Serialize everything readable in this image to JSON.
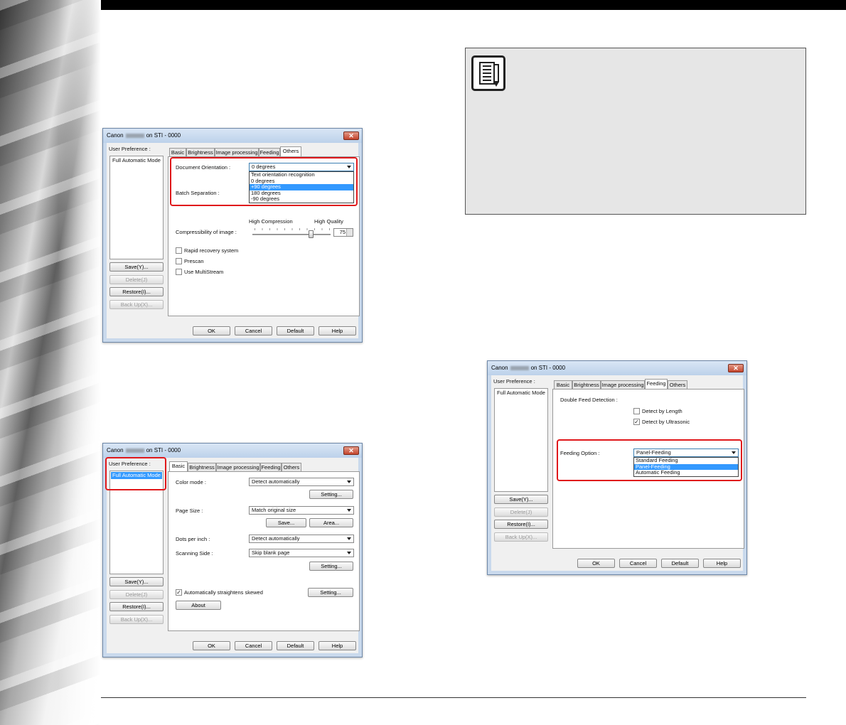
{
  "dialog_title": {
    "prefix": "Canon",
    "suffix": "on STI - 0000",
    "close": "✕"
  },
  "common": {
    "user_preference": "User Preference :",
    "preset_item": "Full Automatic Mode",
    "save": "Save(Y)...",
    "delete": "Delete(J)",
    "restore": "Restore(I)...",
    "backup": "Back Up(X)...",
    "ok": "OK",
    "cancel": "Cancel",
    "default": "Default",
    "help": "Help"
  },
  "tabs": [
    "Basic",
    "Brightness",
    "Image processing",
    "Feeding",
    "Others"
  ],
  "dialog1": {
    "active_tab": "Others",
    "doc_orientation_label": "Document Orientation :",
    "doc_orientation_value": "0 degrees",
    "orientation_options": [
      "Text orientation recognition",
      "0 degrees",
      "+90 degrees",
      "180 degrees",
      "-90 degrees"
    ],
    "orientation_selected_index": 2,
    "batch_separation_label": "Batch Separation :",
    "high_compression": "High Compression",
    "high_quality": "High Quality",
    "compressibility_label": "Compressibility of image :",
    "compressibility_value": "75",
    "compressibility_level": 0.75,
    "rapid_recovery": "Rapid recovery system",
    "prescan": "Prescan",
    "multistream": "Use MultiStream"
  },
  "dialog2": {
    "active_tab": "Basic",
    "color_mode_label": "Color mode :",
    "color_mode_value": "Detect automatically",
    "setting": "Setting...",
    "page_size_label": "Page Size :",
    "page_size_value": "Match original size",
    "save_btn": "Save...",
    "area_btn": "Area...",
    "dpi_label": "Dots per inch :",
    "dpi_value": "Detect automatically",
    "scanning_side_label": "Scanning Side :",
    "scanning_side_value": "Skip blank page",
    "straighten": "Automatically straightens skewed",
    "about": "About"
  },
  "dialog3": {
    "active_tab": "Feeding",
    "double_feed_label": "Double Feed Detection :",
    "detect_length": "Detect by Length",
    "detect_ultrasonic": "Detect by Ultrasonic",
    "feeding_option_label": "Feeding Option :",
    "feeding_value": "Panel-Feeding",
    "feeding_options": [
      "Standard Feeding",
      "Panel-Feeding",
      "Automatic Feeding"
    ],
    "feeding_selected_index": 1
  }
}
